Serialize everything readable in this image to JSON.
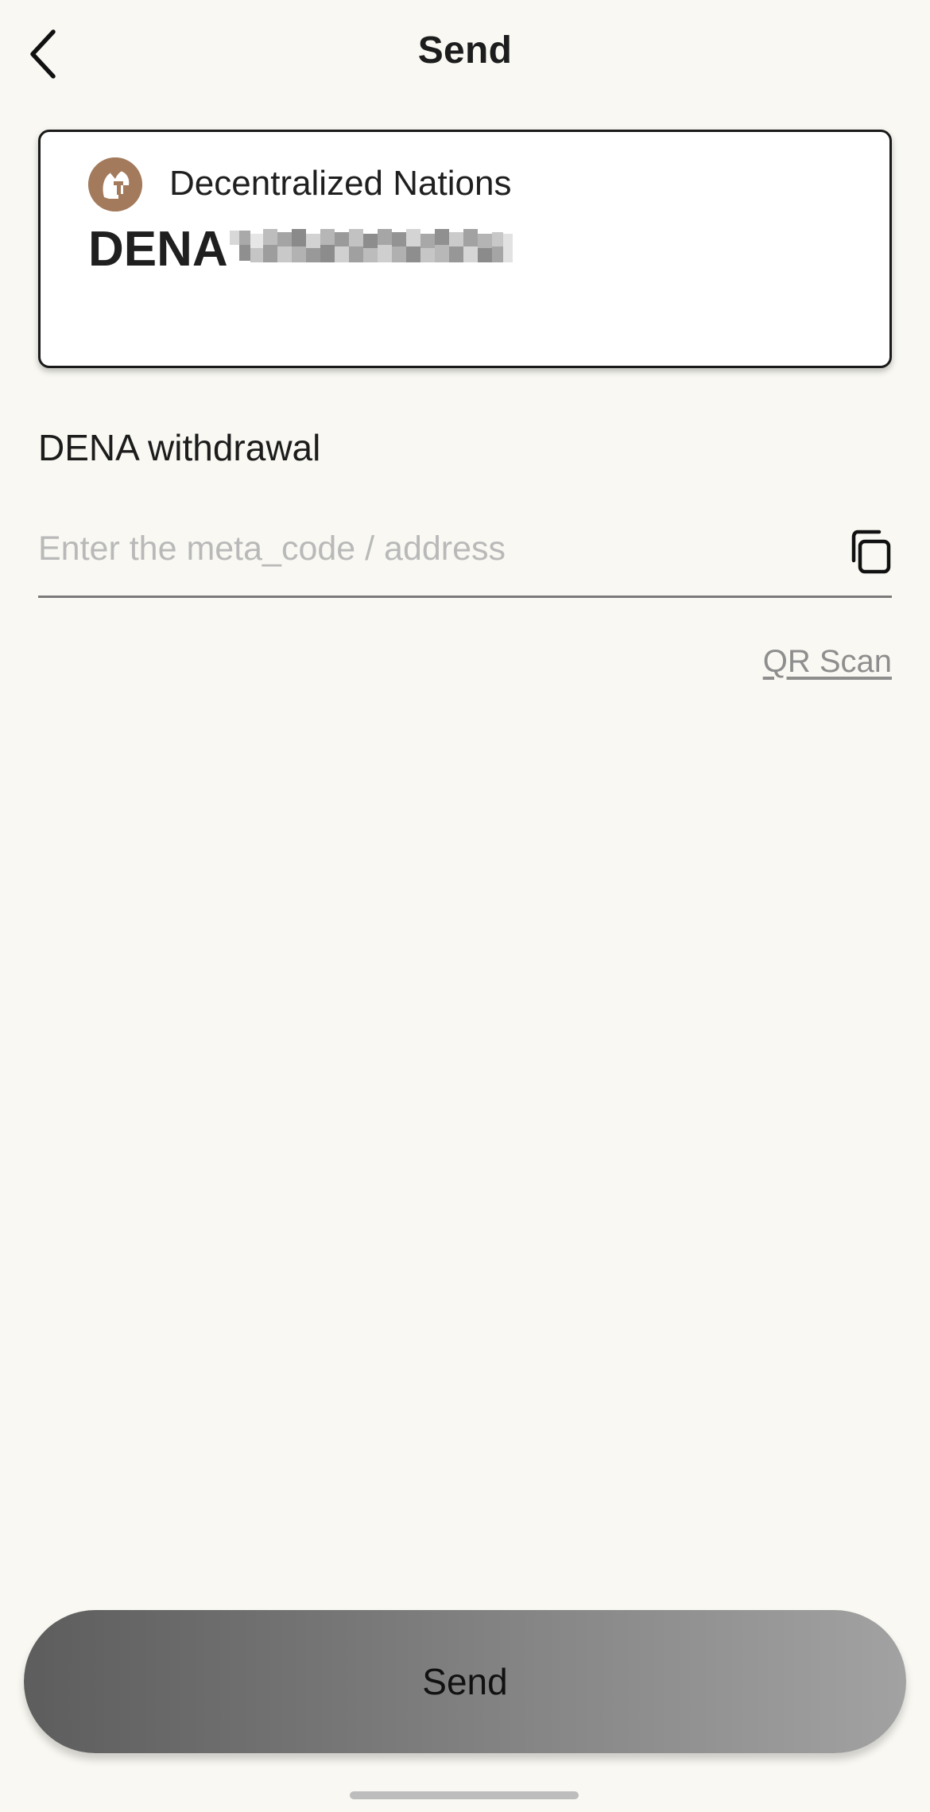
{
  "header": {
    "title": "Send",
    "back_icon": "chevron-left-icon"
  },
  "token": {
    "name": "Decentralized Nations",
    "symbol": "DENA",
    "logo_icon": "spartan-helmet-icon",
    "logo_color": "#a37a5c",
    "balance_obscured": true
  },
  "withdrawal": {
    "label": "DENA withdrawal",
    "address_value": "",
    "address_placeholder": "Enter the meta_code / address",
    "paste_icon": "copy-icon",
    "qr_scan_label": "QR Scan"
  },
  "footer": {
    "send_label": "Send"
  },
  "colors": {
    "background": "#f9f8f2",
    "card": "#ffffff",
    "placeholder": "#b9b9b9",
    "link": "#8e8e8e",
    "button_gradient_start": "#5d5d5d",
    "button_gradient_end": "#a2a2a2"
  }
}
